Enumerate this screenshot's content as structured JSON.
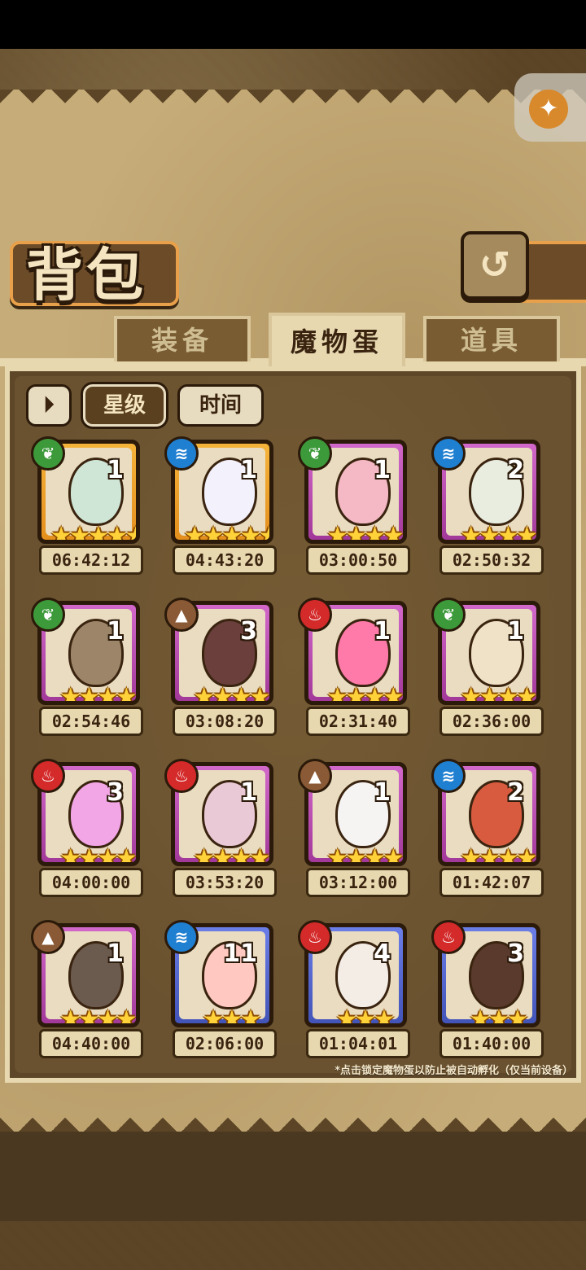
{
  "header": {
    "title": "背包"
  },
  "tabs": [
    {
      "label": "装备",
      "active": false
    },
    {
      "label": "魔物蛋",
      "active": true
    },
    {
      "label": "道具",
      "active": false
    }
  ],
  "sort": {
    "toggle_icon": "sort-toggle-icon",
    "star_label": "星级",
    "time_label": "时间",
    "selected": "星级"
  },
  "eggs": [
    {
      "element": "grass",
      "count": "1",
      "stars": "★★★★★",
      "rarity": "gold",
      "time": "06:42:12",
      "color": "#cfe6d6"
    },
    {
      "element": "water",
      "count": "1",
      "stars": "★★★★★",
      "rarity": "gold",
      "time": "04:43:20",
      "color": "#f3f1fb"
    },
    {
      "element": "grass",
      "count": "1",
      "stars": "★★★★",
      "rarity": "purple",
      "time": "03:00:50",
      "color": "#f4b9c4"
    },
    {
      "element": "water",
      "count": "2",
      "stars": "★★★★",
      "rarity": "purple",
      "time": "02:50:32",
      "color": "#e8ede0"
    },
    {
      "element": "grass",
      "count": "1",
      "stars": "★★★★",
      "rarity": "purple",
      "time": "02:54:46",
      "color": "#9c8568"
    },
    {
      "element": "earth",
      "count": "3",
      "stars": "★★★★",
      "rarity": "purple",
      "time": "03:08:20",
      "color": "#6a3f3c"
    },
    {
      "element": "fire",
      "count": "1",
      "stars": "★★★★",
      "rarity": "purple",
      "time": "02:31:40",
      "color": "#ff7aa8"
    },
    {
      "element": "grass",
      "count": "1",
      "stars": "★★★★",
      "rarity": "purple",
      "time": "02:36:00",
      "color": "#efe2c6"
    },
    {
      "element": "fire",
      "count": "3",
      "stars": "★★★★",
      "rarity": "purple",
      "time": "04:00:00",
      "color": "#f3a6e6"
    },
    {
      "element": "fire",
      "count": "1",
      "stars": "★★★★",
      "rarity": "purple",
      "time": "03:53:20",
      "color": "#e9c9d6"
    },
    {
      "element": "earth",
      "count": "1",
      "stars": "★★★★",
      "rarity": "purple",
      "time": "03:12:00",
      "color": "#f6f4f2"
    },
    {
      "element": "water",
      "count": "2",
      "stars": "★★★★",
      "rarity": "purple",
      "time": "01:42:07",
      "color": "#d85b3f"
    },
    {
      "element": "earth",
      "count": "1",
      "stars": "★★★★",
      "rarity": "purple",
      "time": "04:40:00",
      "color": "#6b5a4e"
    },
    {
      "element": "water",
      "count": "11",
      "stars": "★★★",
      "rarity": "blue",
      "time": "02:06:00",
      "color": "#ffc8c0"
    },
    {
      "element": "fire",
      "count": "4",
      "stars": "★★★",
      "rarity": "blue",
      "time": "01:04:01",
      "color": "#f4ede6"
    },
    {
      "element": "fire",
      "count": "3",
      "stars": "★★★",
      "rarity": "blue",
      "time": "01:40:00",
      "color": "#5a3a2c"
    }
  ],
  "element_glyphs": {
    "grass": "❦",
    "water": "≋",
    "fire": "♨",
    "earth": "▲"
  },
  "footnote": "*点击锁定魔物蛋以防止被自动孵化（仅当前设备）",
  "accessibility_icon": "accessibility-person-icon",
  "back_icon": "back-arrow-icon"
}
